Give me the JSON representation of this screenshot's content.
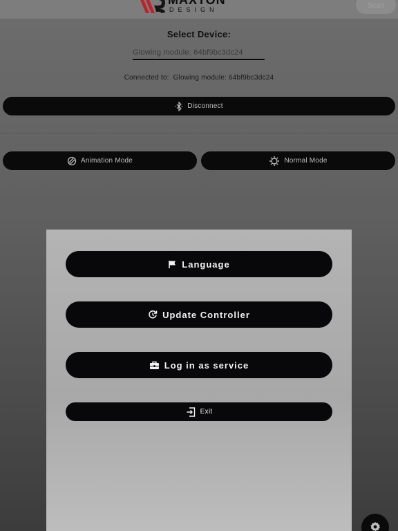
{
  "header": {
    "logo_text_primary": "MAXTON",
    "logo_text_secondary": "DESIGN",
    "scan_label": "Scan"
  },
  "device": {
    "select_label": "Select Device:",
    "selected_value": "Glowing module: 64bf9bc3dc24",
    "connected_prefix": "Connected to:",
    "connected_name": "Glowing module: 64bf9bc3dc24"
  },
  "actions": {
    "disconnect_label": "Disconnect",
    "animation_mode_label": "Animation Mode",
    "normal_mode_label": "Normal Mode"
  },
  "menu": {
    "language_label": "Language",
    "update_label": "Update Controller",
    "service_label": "Log in as service",
    "exit_label": "Exit"
  },
  "icons": {
    "disconnect": "bluetooth-icon",
    "animation_mode": "animation-mode-icon",
    "normal_mode": "sun-icon",
    "language": "flag-icon",
    "update": "refresh-icon",
    "service": "toolbox-icon",
    "exit": "exit-icon",
    "settings": "gear-icon"
  },
  "colors": {
    "button_bg": "#0a0a0b",
    "logo_red": "#c0222a",
    "sheet_bg": "#b4b4b4"
  }
}
